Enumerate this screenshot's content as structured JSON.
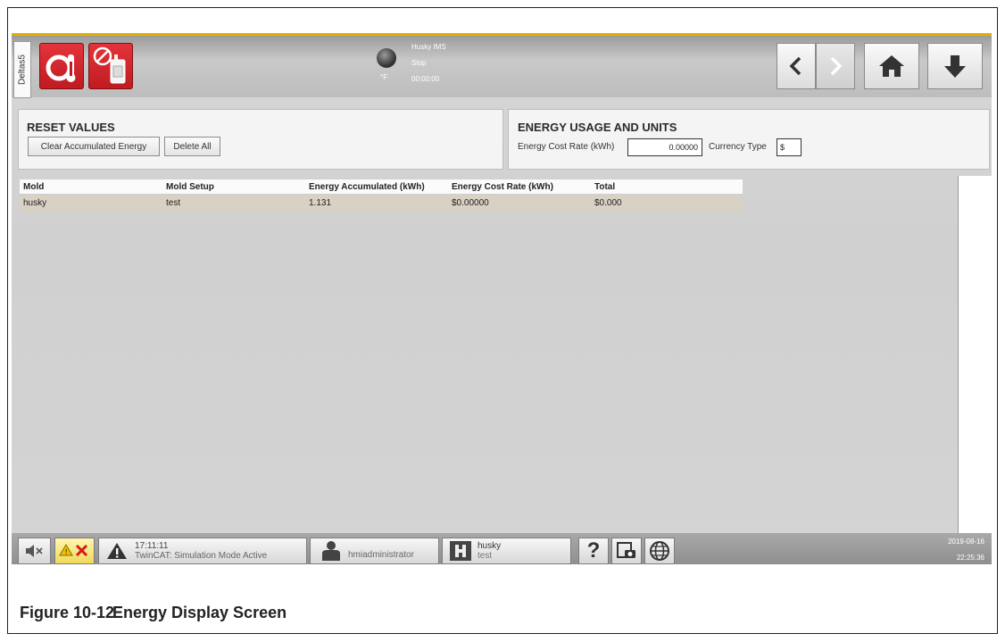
{
  "header": {
    "side_tab": "Deltas5",
    "status": {
      "name": "Husky IMS",
      "state": "Stop",
      "time": "00:00:00",
      "unit": "°F"
    }
  },
  "reset_panel": {
    "title": "RESET VALUES",
    "clear_label": "Clear Accumulated Energy",
    "delete_label": "Delete All"
  },
  "energy_panel": {
    "title": "ENERGY USAGE AND UNITS",
    "cost_rate_label": "Energy Cost Rate (kWh)",
    "cost_rate_value": "0.00000",
    "currency_label": "Currency Type",
    "currency_value": "$"
  },
  "table": {
    "columns": [
      "Mold",
      "Mold Setup",
      "Energy Accumulated (kWh)",
      "Energy Cost Rate (kWh)",
      "Total"
    ],
    "rows": [
      [
        "husky",
        "test",
        "1.131",
        "$0.00000",
        "$0.000"
      ]
    ]
  },
  "footer": {
    "alarm_time": "17:11:11",
    "alarm_text": "TwinCAT: Simulation Mode Active",
    "user": "hmiadministrator",
    "mold_name": "husky",
    "mold_setup": "test",
    "date": "2019-08-16",
    "time": "22:25:36"
  },
  "caption": {
    "number": "Figure 10-12",
    "title": "Energy Display Screen"
  },
  "colors": {
    "accent": "#e3b100",
    "red_button": "#d4262d",
    "row_highlight": "#d8d1c4"
  }
}
